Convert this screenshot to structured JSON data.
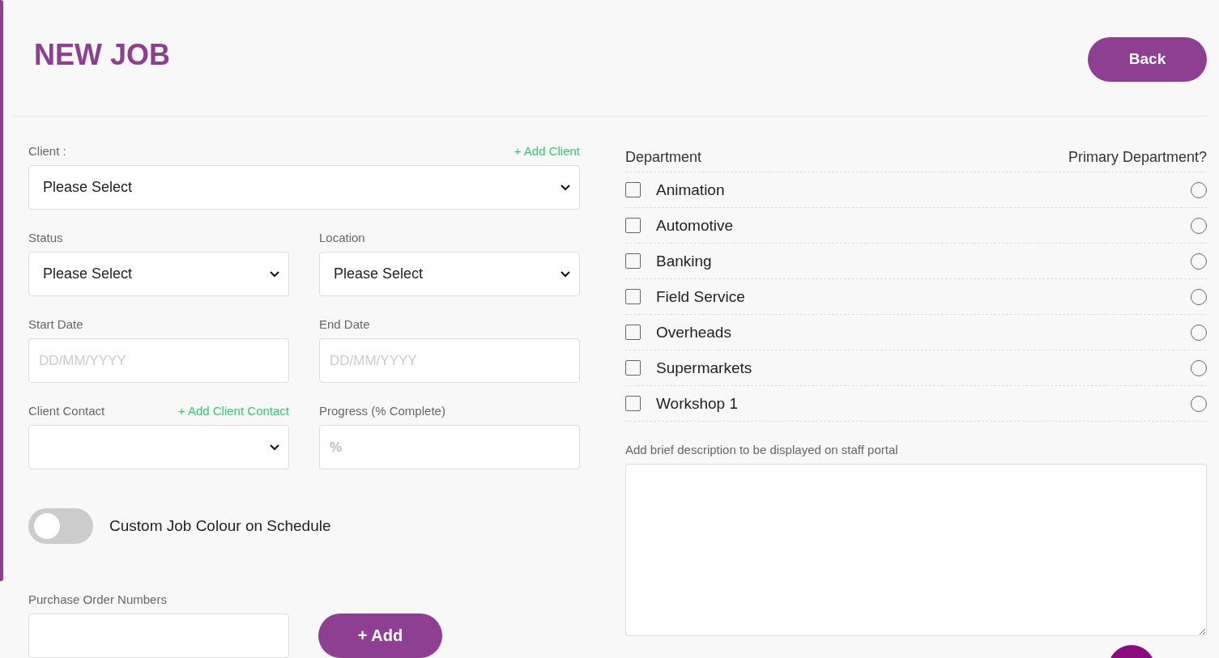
{
  "title": "NEW JOB",
  "back_button": "Back",
  "client": {
    "label": "Client :",
    "add_link": "+ Add Client",
    "value": "Please Select"
  },
  "status": {
    "label": "Status",
    "value": "Please Select"
  },
  "location": {
    "label": "Location",
    "value": "Please Select"
  },
  "start_date": {
    "label": "Start Date",
    "placeholder": "DD/MM/YYYY"
  },
  "end_date": {
    "label": "End Date",
    "placeholder": "DD/MM/YYYY"
  },
  "client_contact": {
    "label": "Client Contact",
    "add_link": "+ Add Client Contact"
  },
  "progress": {
    "label": "Progress (% Complete)",
    "placeholder": "%"
  },
  "custom_colour": {
    "label": "Custom Job Colour on Schedule",
    "on": false
  },
  "purchase_orders": {
    "label": "Purchase Order Numbers",
    "add_button": "+ Add"
  },
  "departments": {
    "heading": "Department",
    "primary_heading": "Primary Department?",
    "items": [
      {
        "name": "Animation",
        "checked": false,
        "selected": false
      },
      {
        "name": "Automotive",
        "checked": false,
        "selected": false
      },
      {
        "name": "Banking",
        "checked": false,
        "selected": false
      },
      {
        "name": "Field Service",
        "checked": false,
        "selected": false
      },
      {
        "name": "Overheads",
        "checked": false,
        "selected": false
      },
      {
        "name": "Supermarkets",
        "checked": false,
        "selected": false
      },
      {
        "name": "Workshop 1",
        "checked": false,
        "selected": false
      }
    ]
  },
  "description": {
    "label": "Add brief description to be displayed on staff portal"
  }
}
